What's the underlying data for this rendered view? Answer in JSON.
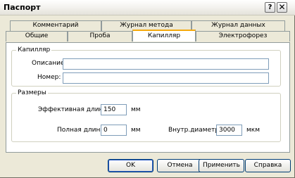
{
  "window": {
    "title": "Паспорт",
    "help_glyph": "?",
    "close_glyph": "✕"
  },
  "tabs_row1": [
    {
      "label": "Комментарий"
    },
    {
      "label": "Журнал метода"
    },
    {
      "label": "Журнал данных"
    }
  ],
  "tabs_row2": [
    {
      "label": "Общие"
    },
    {
      "label": "Проба"
    },
    {
      "label": "Капилляр",
      "active": true
    },
    {
      "label": "Электрофорез"
    }
  ],
  "capillary": {
    "legend": "Капилляр",
    "description_label": "Описание:",
    "description_value": "",
    "number_label": "Номер:",
    "number_value": ""
  },
  "sizes": {
    "legend": "Размеры",
    "effective_length_label": "Эффективная длина",
    "effective_length_value": "150",
    "effective_length_unit": "мм",
    "total_length_label": "Полная длина",
    "total_length_value": "0",
    "total_length_unit": "мм",
    "inner_diameter_label": "Внутр.диаметр:",
    "inner_diameter_value": "3000",
    "inner_diameter_unit": "мкм"
  },
  "buttons": {
    "ok": "OK",
    "cancel": "Отмена",
    "apply": "Применить",
    "help": "Справка"
  }
}
